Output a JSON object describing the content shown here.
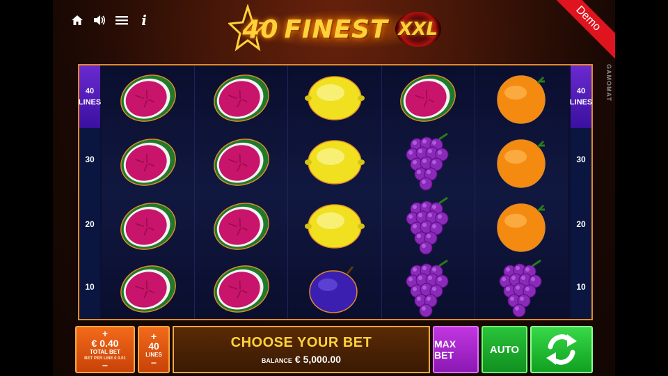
{
  "game_title": {
    "number": "40",
    "word": "FINEST",
    "suffix": "XXL"
  },
  "demo_label": "Demo",
  "brand": "GAMOMAT",
  "toolbar": {
    "icons": [
      "home-icon",
      "sound-icon",
      "menu-icon",
      "info-icon"
    ],
    "info_label": "i"
  },
  "lines": {
    "active_top": "40",
    "active_label": "LINES",
    "markers": [
      "30",
      "20",
      "10"
    ]
  },
  "reels": [
    [
      "watermelon",
      "watermelon",
      "watermelon",
      "watermelon"
    ],
    [
      "watermelon",
      "watermelon",
      "watermelon",
      "watermelon"
    ],
    [
      "lemon",
      "lemon",
      "lemon",
      "plum"
    ],
    [
      "watermelon",
      "grapes",
      "grapes",
      "grapes"
    ],
    [
      "orange",
      "orange",
      "orange",
      "grapes"
    ]
  ],
  "bet": {
    "plus": "+",
    "minus": "−",
    "total_bet": "€ 0.40",
    "total_bet_label": "TOTAL BET",
    "bet_per_line": "BET PER LINE € 0.01"
  },
  "lines_btn": {
    "plus": "+",
    "minus": "−",
    "value": "40",
    "label": "LINES"
  },
  "message": {
    "title": "CHOOSE YOUR BET",
    "balance_label": "BALANCE",
    "balance": "€ 5,000.00"
  },
  "max_bet_label": "MAX BET",
  "auto_label": "AUTO",
  "colors": {
    "frame": "#e28a2a",
    "bet_button": "#e2561a",
    "max_bet": "#a826cc",
    "auto": "#22b432",
    "spin": "#28c838",
    "title_gold": "#ffd23a"
  }
}
